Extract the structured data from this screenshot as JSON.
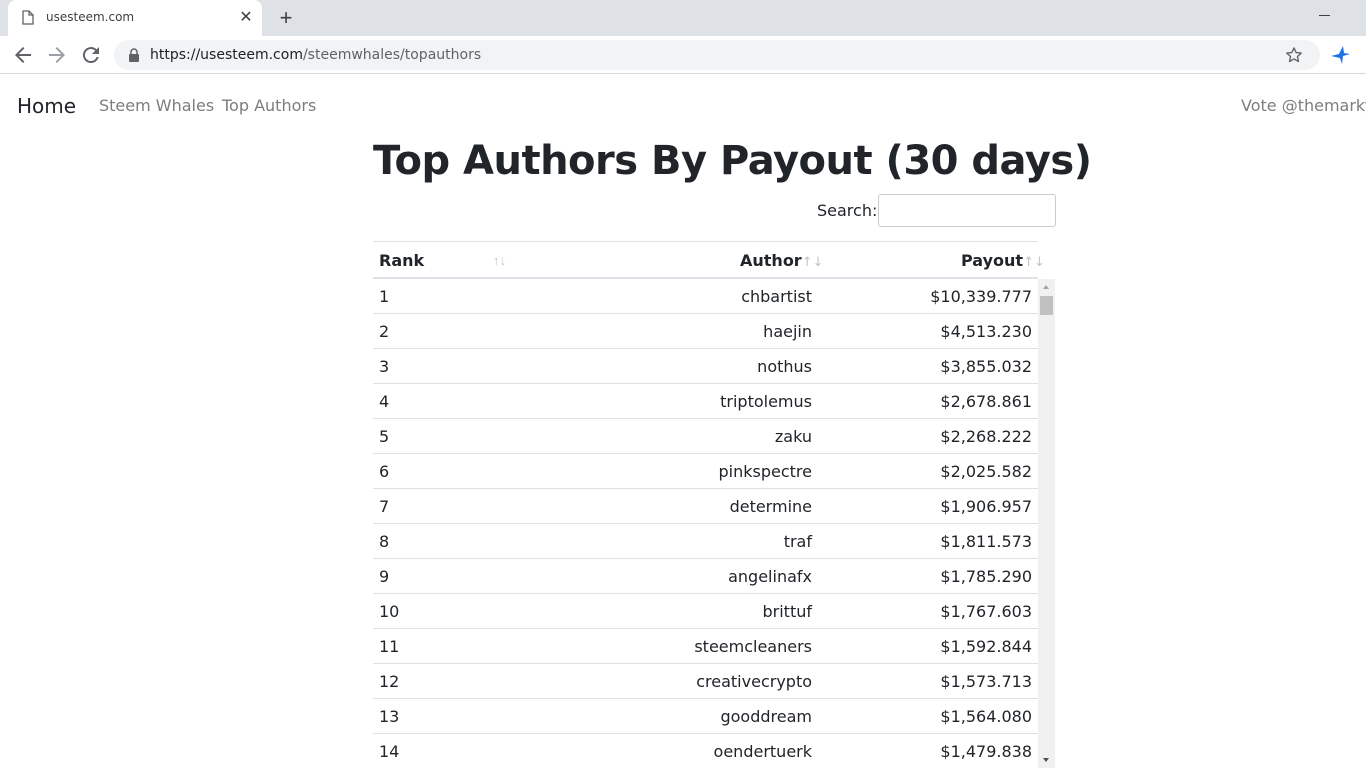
{
  "browser": {
    "tab_title": "usesteem.com",
    "close_glyph": "✕",
    "new_tab_glyph": "+",
    "url_host": "https://usesteem.com",
    "url_path": "/steemwhales/topauthors"
  },
  "navbar": {
    "brand": "Home",
    "links": [
      "Steem Whales",
      "Top Authors"
    ],
    "right": "Vote @themarkymark"
  },
  "page": {
    "title": "Top Authors By Payout (30 days)",
    "search_label": "Search:",
    "search_value": ""
  },
  "table": {
    "columns": [
      "Rank",
      "Author",
      "Payout"
    ],
    "rows": [
      {
        "rank": "1",
        "author": "chbartist",
        "payout": "$10,339.777"
      },
      {
        "rank": "2",
        "author": "haejin",
        "payout": "$4,513.230"
      },
      {
        "rank": "3",
        "author": "nothus",
        "payout": "$3,855.032"
      },
      {
        "rank": "4",
        "author": "triptolemus",
        "payout": "$2,678.861"
      },
      {
        "rank": "5",
        "author": "zaku",
        "payout": "$2,268.222"
      },
      {
        "rank": "6",
        "author": "pinkspectre",
        "payout": "$2,025.582"
      },
      {
        "rank": "7",
        "author": "determine",
        "payout": "$1,906.957"
      },
      {
        "rank": "8",
        "author": "traf",
        "payout": "$1,811.573"
      },
      {
        "rank": "9",
        "author": "angelinafx",
        "payout": "$1,785.290"
      },
      {
        "rank": "10",
        "author": "brittuf",
        "payout": "$1,767.603"
      },
      {
        "rank": "11",
        "author": "steemcleaners",
        "payout": "$1,592.844"
      },
      {
        "rank": "12",
        "author": "creativecrypto",
        "payout": "$1,573.713"
      },
      {
        "rank": "13",
        "author": "gooddream",
        "payout": "$1,564.080"
      },
      {
        "rank": "14",
        "author": "oendertuerk",
        "payout": "$1,479.838"
      }
    ]
  },
  "icons": {
    "tab": "page-icon",
    "back": "arrow-left-icon",
    "forward": "arrow-right-icon",
    "reload": "reload-icon",
    "lock": "lock-icon",
    "bookmark": "star-icon",
    "extension": "extension-icon",
    "sort": "sort-icon"
  },
  "colors": {
    "chrome_bg": "#dee1e6",
    "omnibox_bg": "#f1f3f4",
    "nav_link": "#7d7d7d",
    "text": "#212529",
    "border": "#dee2e6",
    "extension_accent": "#1a73e8"
  }
}
